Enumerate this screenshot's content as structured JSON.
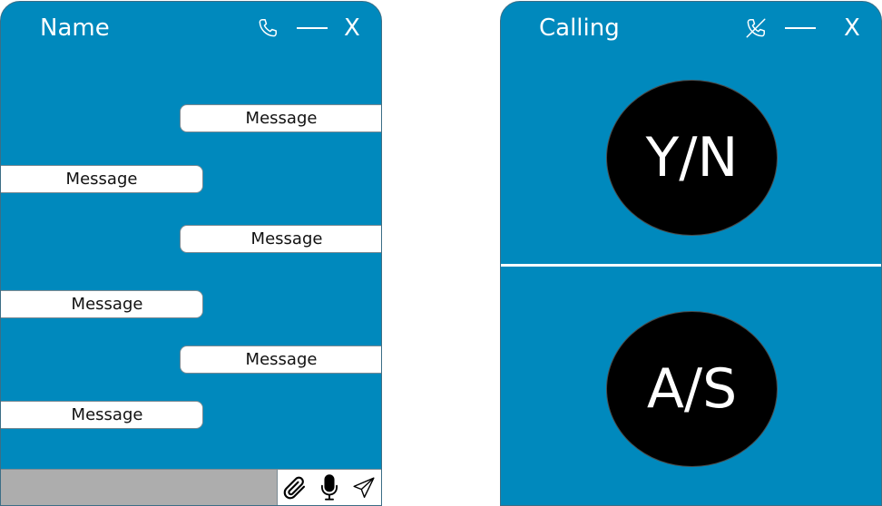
{
  "chat": {
    "title": "Name",
    "close_label": "X",
    "messages": [
      {
        "text": "Message",
        "side": "outgoing"
      },
      {
        "text": "Message",
        "side": "incoming"
      },
      {
        "text": "Message",
        "side": "outgoing"
      },
      {
        "text": "Message",
        "side": "incoming"
      },
      {
        "text": "Message",
        "side": "outgoing"
      },
      {
        "text": "Message",
        "side": "incoming"
      }
    ],
    "composer": {
      "value": "",
      "placeholder": ""
    }
  },
  "call": {
    "title": "Calling",
    "close_label": "X",
    "participants": [
      {
        "initials": "Y/N"
      },
      {
        "initials": "A/S"
      }
    ]
  },
  "icons": {
    "call": "phone-icon",
    "end_call": "phone-off-icon",
    "minimize": "minimize-icon",
    "attach": "paperclip-icon",
    "mic": "microphone-icon",
    "send": "send-icon"
  },
  "colors": {
    "panel_bg": "#0089bd",
    "bubble_bg": "#ffffff",
    "composer_bg": "#adadad",
    "avatar_bg": "#000000"
  }
}
